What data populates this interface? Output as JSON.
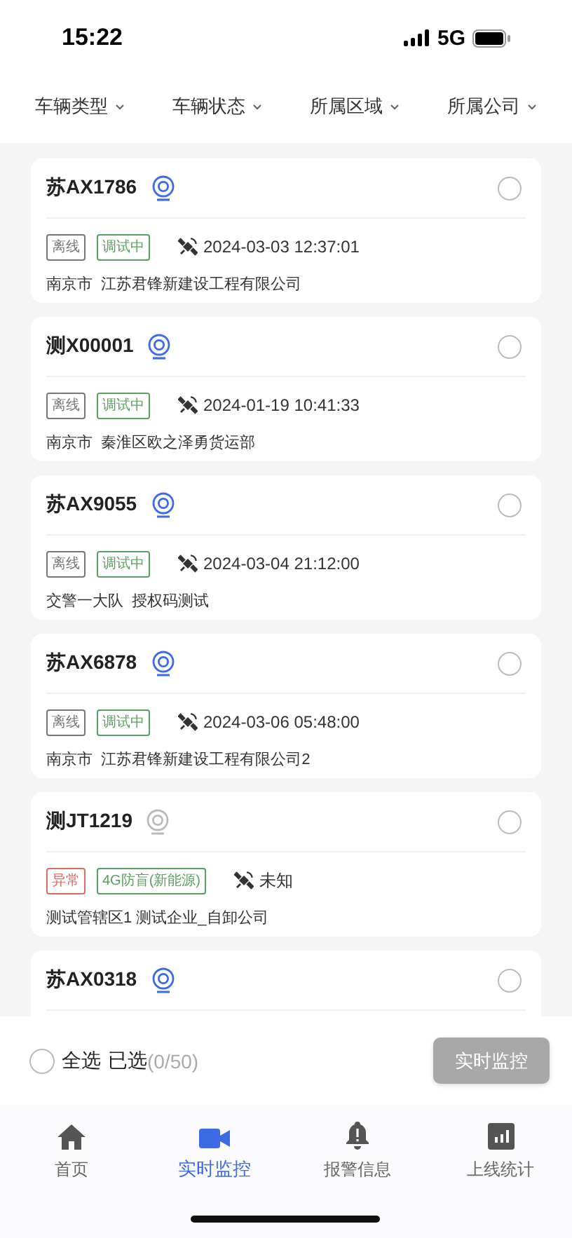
{
  "status_bar": {
    "time": "15:22",
    "network": "5G"
  },
  "filters": [
    {
      "label": "车辆类型"
    },
    {
      "label": "车辆状态"
    },
    {
      "label": "所属区域"
    },
    {
      "label": "所属公司"
    }
  ],
  "vehicles": [
    {
      "plate": "苏AX1786",
      "camera_active": true,
      "selected": false,
      "status_tag": {
        "text": "离线",
        "kind": "offline"
      },
      "device_tag": "调试中",
      "location_time": "2024-03-03 12:37:01",
      "address": "南京市  江苏君锋新建设工程有限公司"
    },
    {
      "plate": "测X00001",
      "camera_active": true,
      "selected": false,
      "status_tag": {
        "text": "离线",
        "kind": "offline"
      },
      "device_tag": "调试中",
      "location_time": "2024-01-19 10:41:33",
      "address": "南京市  秦淮区欧之泽勇货运部"
    },
    {
      "plate": "苏AX9055",
      "camera_active": true,
      "selected": false,
      "status_tag": {
        "text": "离线",
        "kind": "offline"
      },
      "device_tag": "调试中",
      "location_time": "2024-03-04 21:12:00",
      "address": "交警一大队  授权码测试"
    },
    {
      "plate": "苏AX6878",
      "camera_active": true,
      "selected": false,
      "status_tag": {
        "text": "离线",
        "kind": "offline"
      },
      "device_tag": "调试中",
      "location_time": "2024-03-06 05:48:00",
      "address": "南京市  江苏君锋新建设工程有限公司2"
    },
    {
      "plate": "测JT1219",
      "camera_active": false,
      "selected": false,
      "status_tag": {
        "text": "异常",
        "kind": "abnormal"
      },
      "device_tag": "4G防盲(新能源)",
      "location_time": "未知",
      "address": "测试管辖区1 测试企业_自卸公司"
    },
    {
      "plate": "苏AX0318",
      "camera_active": true,
      "selected": false
    }
  ],
  "selection": {
    "all_selected": false,
    "select_all_label": "全选",
    "selected_label": "已选",
    "selected_count": "(0/50)"
  },
  "monitor_button": {
    "label": "实时监控",
    "disabled": true
  },
  "tabs": [
    {
      "label": "首页",
      "kind": "home",
      "selected": false
    },
    {
      "label": "实时监控",
      "kind": "video",
      "selected": true
    },
    {
      "label": "报警信息",
      "kind": "bell",
      "selected": false
    },
    {
      "label": "上线统计",
      "kind": "chart",
      "selected": false
    }
  ]
}
